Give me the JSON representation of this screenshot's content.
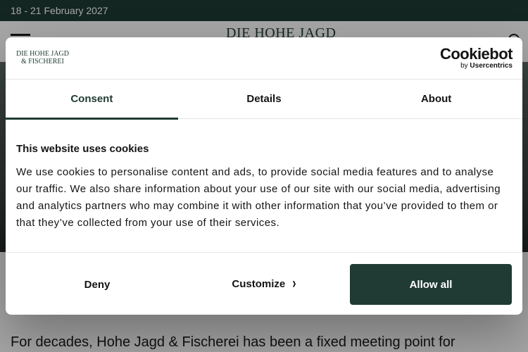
{
  "page": {
    "event_dates": "18 - 21 February 2027",
    "site_logo": "DIE HOHE JAGD",
    "intro_text": "For decades, Hohe Jagd & Fischerei has been a fixed meeting point for"
  },
  "dialog": {
    "logo_line1": "DIE HOHE JAGD",
    "logo_line2": "& FISCHEREI",
    "brand_main": "Cookiebot",
    "brand_sub_prefix": "by ",
    "brand_sub_name": "Usercentrics",
    "tabs": [
      {
        "label": "Consent",
        "active": true
      },
      {
        "label": "Details",
        "active": false
      },
      {
        "label": "About",
        "active": false
      }
    ],
    "title": "This website uses cookies",
    "text": "We use cookies to personalise content and ads, to provide social media features and to analyse our traffic. We also share information about your use of our site with our social media, advertising and analytics partners who may combine it with other information that you’ve provided to them or that they’ve collected from your use of their services.",
    "buttons": {
      "deny": "Deny",
      "customize": "Customize",
      "allow_all": "Allow all"
    }
  },
  "colors": {
    "brand_green": "#1f3b33",
    "text": "#141414"
  }
}
